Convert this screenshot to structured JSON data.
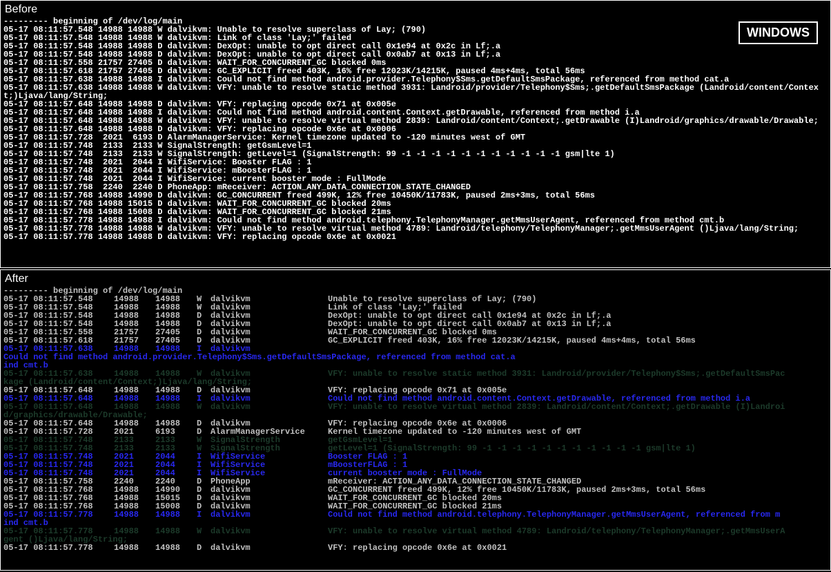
{
  "badge": "WINDOWS",
  "before": {
    "title": "Before",
    "header": "--------- beginning of /dev/log/main",
    "lines": [
      "05-17 08:11:57.548 14988 14988 W dalvikvm: Unable to resolve superclass of Lay; (790)",
      "05-17 08:11:57.548 14988 14988 W dalvikvm: Link of class 'Lay;' failed",
      "05-17 08:11:57.548 14988 14988 D dalvikvm: DexOpt: unable to opt direct call 0x1e94 at 0x2c in Lf;.a",
      "05-17 08:11:57.548 14988 14988 D dalvikvm: DexOpt: unable to opt direct call 0x0ab7 at 0x13 in Lf;.a",
      "05-17 08:11:57.558 21757 27405 D dalvikvm: WAIT_FOR_CONCURRENT_GC blocked 0ms",
      "05-17 08:11:57.618 21757 27405 D dalvikvm: GC_EXPLICIT freed 403K, 16% free 12023K/14215K, paused 4ms+4ms, total 56ms",
      "05-17 08:11:57.638 14988 14988 I dalvikvm: Could not find method android.provider.Telephony$Sms.getDefaultSmsPackage, referenced from method cat.a",
      "05-17 08:11:57.638 14988 14988 W dalvikvm: VFY: unable to resolve static method 3931: Landroid/provider/Telephony$Sms;.getDefaultSmsPackage (Landroid/content/Context;)Ljava/lang/String;",
      "05-17 08:11:57.648 14988 14988 D dalvikvm: VFY: replacing opcode 0x71 at 0x005e",
      "05-17 08:11:57.648 14988 14988 I dalvikvm: Could not find method android.content.Context.getDrawable, referenced from method i.a",
      "05-17 08:11:57.648 14988 14988 W dalvikvm: VFY: unable to resolve virtual method 2839: Landroid/content/Context;.getDrawable (I)Landroid/graphics/drawable/Drawable;",
      "05-17 08:11:57.648 14988 14988 D dalvikvm: VFY: replacing opcode 0x6e at 0x0006",
      "05-17 08:11:57.728  2021  6193 D AlarmManagerService: Kernel timezone updated to -120 minutes west of GMT",
      "05-17 08:11:57.748  2133  2133 W SignalStrength: getGsmLevel=1",
      "05-17 08:11:57.748  2133  2133 W SignalStrength: getLevel=1 (SignalStrength: 99 -1 -1 -1 -1 -1 -1 -1 -1 -1 -1 -1 gsm|lte 1)",
      "05-17 08:11:57.748  2021  2044 I WifiService: Booster FLAG : 1",
      "05-17 08:11:57.748  2021  2044 I WifiService: mBoosterFLAG : 1",
      "05-17 08:11:57.748  2021  2044 I WifiService: current booster mode : FullMode",
      "05-17 08:11:57.758  2240  2240 D PhoneApp: mReceiver: ACTION_ANY_DATA_CONNECTION_STATE_CHANGED",
      "05-17 08:11:57.768 14988 14990 D dalvikvm: GC_CONCURRENT freed 499K, 12% free 10450K/11783K, paused 2ms+3ms, total 56ms",
      "05-17 08:11:57.768 14988 15015 D dalvikvm: WAIT_FOR_CONCURRENT_GC blocked 20ms",
      "05-17 08:11:57.768 14988 15008 D dalvikvm: WAIT_FOR_CONCURRENT_GC blocked 21ms",
      "05-17 08:11:57.778 14988 14988 I dalvikvm: Could not find method android.telephony.TelephonyManager.getMmsUserAgent, referenced from method cmt.b",
      "05-17 08:11:57.778 14988 14988 W dalvikvm: VFY: unable to resolve virtual method 4789: Landroid/telephony/TelephonyManager;.getMmsUserAgent ()Ljava/lang/String;",
      "05-17 08:11:57.778 14988 14988 D dalvikvm: VFY: replacing opcode 0x6e at 0x0021"
    ]
  },
  "after": {
    "title": "After",
    "header": "--------- beginning of /dev/log/main",
    "rows": [
      {
        "c": "c0",
        "d": "05-17 08:11:57.548",
        "p": "14988",
        "t": "14988",
        "l": "W",
        "tag": "dalvikvm",
        "msg": "Unable to resolve superclass of Lay; (790)"
      },
      {
        "c": "c0",
        "d": "05-17 08:11:57.548",
        "p": "14988",
        "t": "14988",
        "l": "W",
        "tag": "dalvikvm",
        "msg": "Link of class 'Lay;' failed"
      },
      {
        "c": "c0",
        "d": "05-17 08:11:57.548",
        "p": "14988",
        "t": "14988",
        "l": "D",
        "tag": "dalvikvm",
        "msg": "DexOpt: unable to opt direct call 0x1e94 at 0x2c in Lf;.a"
      },
      {
        "c": "c0",
        "d": "05-17 08:11:57.548",
        "p": "14988",
        "t": "14988",
        "l": "D",
        "tag": "dalvikvm",
        "msg": "DexOpt: unable to opt direct call 0x0ab7 at 0x13 in Lf;.a"
      },
      {
        "c": "c0",
        "d": "05-17 08:11:57.558",
        "p": "21757",
        "t": "27405",
        "l": "D",
        "tag": "dalvikvm",
        "msg": "WAIT_FOR_CONCURRENT_GC blocked 0ms"
      },
      {
        "c": "c0",
        "d": "05-17 08:11:57.618",
        "p": "21757",
        "t": "27405",
        "l": "D",
        "tag": "dalvikvm",
        "msg": "GC_EXPLICIT freed 403K, 16% free 12023K/14215K, paused 4ms+4ms, total 56ms"
      },
      {
        "c": "c1",
        "d": "05-17 08:11:57.638",
        "p": "14988",
        "t": "14988",
        "l": "I",
        "tag": "dalvikvm",
        "msg": "Could not find method android.provider.Telephony$Sms.getDefaultSmsPackage, referenced from method cat.a",
        "wrap": "ind cmt.b"
      },
      {
        "c": "c2",
        "d": "05-17 08:11:57.638",
        "p": "14988",
        "t": "14988",
        "l": "W",
        "tag": "dalvikvm",
        "msg": "VFY: unable to resolve static method 3931: Landroid/provider/Telephony$Sms;.getDefaultSmsPac",
        "wrap": "kage (Landroid/content/Context;)Ljava/lang/String;"
      },
      {
        "c": "c0",
        "d": "05-17 08:11:57.648",
        "p": "14988",
        "t": "14988",
        "l": "D",
        "tag": "dalvikvm",
        "msg": "VFY: replacing opcode 0x71 at 0x005e"
      },
      {
        "c": "c1",
        "d": "05-17 08:11:57.648",
        "p": "14988",
        "t": "14988",
        "l": "I",
        "tag": "dalvikvm",
        "msg": "Could not find method android.content.Context.getDrawable, referenced from method i.a"
      },
      {
        "c": "c2",
        "d": "05-17 08:11:57.648",
        "p": "14988",
        "t": "14988",
        "l": "W",
        "tag": "dalvikvm",
        "msg": "VFY: unable to resolve virtual method 2839: Landroid/content/Context;.getDrawable (I)Landroi",
        "wrap": "d/graphics/drawable/Drawable;"
      },
      {
        "c": "c0",
        "d": "05-17 08:11:57.648",
        "p": "14988",
        "t": "14988",
        "l": "D",
        "tag": "dalvikvm",
        "msg": "VFY: replacing opcode 0x6e at 0x0006"
      },
      {
        "c": "c0",
        "d": "05-17 08:11:57.728",
        "p": "2021",
        "t": "6193",
        "l": "D",
        "tag": "AlarmManagerService",
        "msg": "Kernel timezone updated to -120 minutes west of GMT"
      },
      {
        "c": "c2",
        "d": "05-17 08:11:57.748",
        "p": "2133",
        "t": "2133",
        "l": "W",
        "tag": "SignalStrength",
        "msg": "getGsmLevel=1"
      },
      {
        "c": "c2",
        "d": "05-17 08:11:57.748",
        "p": "2133",
        "t": "2133",
        "l": "W",
        "tag": "SignalStrength",
        "msg": "getLevel=1 (SignalStrength: 99 -1 -1 -1 -1 -1 -1 -1 -1 -1 -1 -1 gsm|lte 1)"
      },
      {
        "c": "c1",
        "d": "05-17 08:11:57.748",
        "p": "2021",
        "t": "2044",
        "l": "I",
        "tag": "WifiService",
        "msg": "Booster FLAG : 1"
      },
      {
        "c": "c1",
        "d": "05-17 08:11:57.748",
        "p": "2021",
        "t": "2044",
        "l": "I",
        "tag": "WifiService",
        "msg": "mBoosterFLAG : 1"
      },
      {
        "c": "c1",
        "d": "05-17 08:11:57.748",
        "p": "2021",
        "t": "2044",
        "l": "I",
        "tag": "WifiService",
        "msg": "current booster mode : FullMode"
      },
      {
        "c": "c0",
        "d": "05-17 08:11:57.758",
        "p": "2240",
        "t": "2240",
        "l": "D",
        "tag": "PhoneApp",
        "msg": "mReceiver: ACTION_ANY_DATA_CONNECTION_STATE_CHANGED"
      },
      {
        "c": "c0",
        "d": "05-17 08:11:57.768",
        "p": "14988",
        "t": "14990",
        "l": "D",
        "tag": "dalvikvm",
        "msg": "GC_CONCURRENT freed 499K, 12% free 10450K/11783K, paused 2ms+3ms, total 56ms"
      },
      {
        "c": "c0",
        "d": "05-17 08:11:57.768",
        "p": "14988",
        "t": "15015",
        "l": "D",
        "tag": "dalvikvm",
        "msg": "WAIT_FOR_CONCURRENT_GC blocked 20ms"
      },
      {
        "c": "c0",
        "d": "05-17 08:11:57.768",
        "p": "14988",
        "t": "15008",
        "l": "D",
        "tag": "dalvikvm",
        "msg": "WAIT_FOR_CONCURRENT_GC blocked 21ms"
      },
      {
        "c": "c1",
        "d": "05-17 08:11:57.778",
        "p": "14988",
        "t": "14988",
        "l": "I",
        "tag": "dalvikvm",
        "msg": "Could not find method android.telephony.TelephonyManager.getMmsUserAgent, referenced from m",
        "wrap": "ind cmt.b"
      },
      {
        "c": "c2",
        "d": "05-17 08:11:57.778",
        "p": "14988",
        "t": "14988",
        "l": "W",
        "tag": "dalvikvm",
        "msg": "VFY: unable to resolve virtual method 4789: Landroid/telephony/TelephonyManager;.getMmsUserA",
        "wrap": "gent ()Ljava/lang/String;"
      },
      {
        "c": "c0",
        "d": "05-17 08:11:57.778",
        "p": "14988",
        "t": "14988",
        "l": "D",
        "tag": "dalvikvm",
        "msg": "VFY: replacing opcode 0x6e at 0x0021"
      }
    ]
  }
}
